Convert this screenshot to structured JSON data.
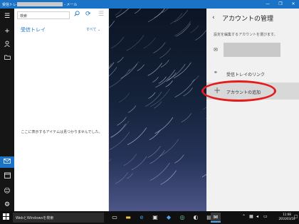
{
  "window": {
    "app_title": "受信トレイ",
    "suffix": "- メール",
    "minimize": "—",
    "maximize": "❐",
    "close": "✕"
  },
  "rail": [
    "hamburger-icon",
    "compose-icon",
    "people-icon",
    "folder-icon",
    "mail-icon",
    "calendar-icon",
    "smiley-icon",
    "settings-icon"
  ],
  "list": {
    "search_placeholder": "検索",
    "folder_title": "受信トレイ",
    "filter_label": "すべて ⌄",
    "empty_message": "ここに表示するアイテムは見つかりませんでした。"
  },
  "panel": {
    "title": "アカウントの管理",
    "hint": "設定を編集するアカウントを選びます。",
    "link_inboxes": "受信トレイのリンク",
    "add_account": "アカウントの追加"
  },
  "taskbar": {
    "search_placeholder": "WebとWindowsを検索",
    "time": "11:08",
    "date": "2016/03/18"
  },
  "colors": {
    "accent": "#1a73c7",
    "highlight": "#e41c1c",
    "panel_bg": "#f1f1f1"
  }
}
